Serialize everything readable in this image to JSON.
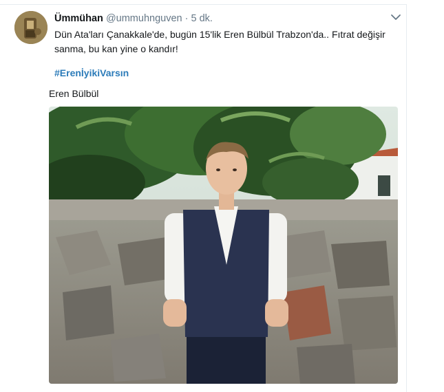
{
  "tweet": {
    "author_name": "Ümmühan",
    "author_handle": "@ummuhnguven",
    "separator": "·",
    "timestamp": "5 dk.",
    "text": "Dün Ata'ları Çanakkale'de, bugün 15'lik Eren Bülbül Trabzon'da.. Fıtrat değişir sanma, bu kan yine o kandır!",
    "hashtag": "#ErenİyikiVarsın",
    "image_caption": "Eren Bülbül"
  },
  "icons": {
    "avatar": "avatar",
    "menu": "chevron-down-icon"
  }
}
